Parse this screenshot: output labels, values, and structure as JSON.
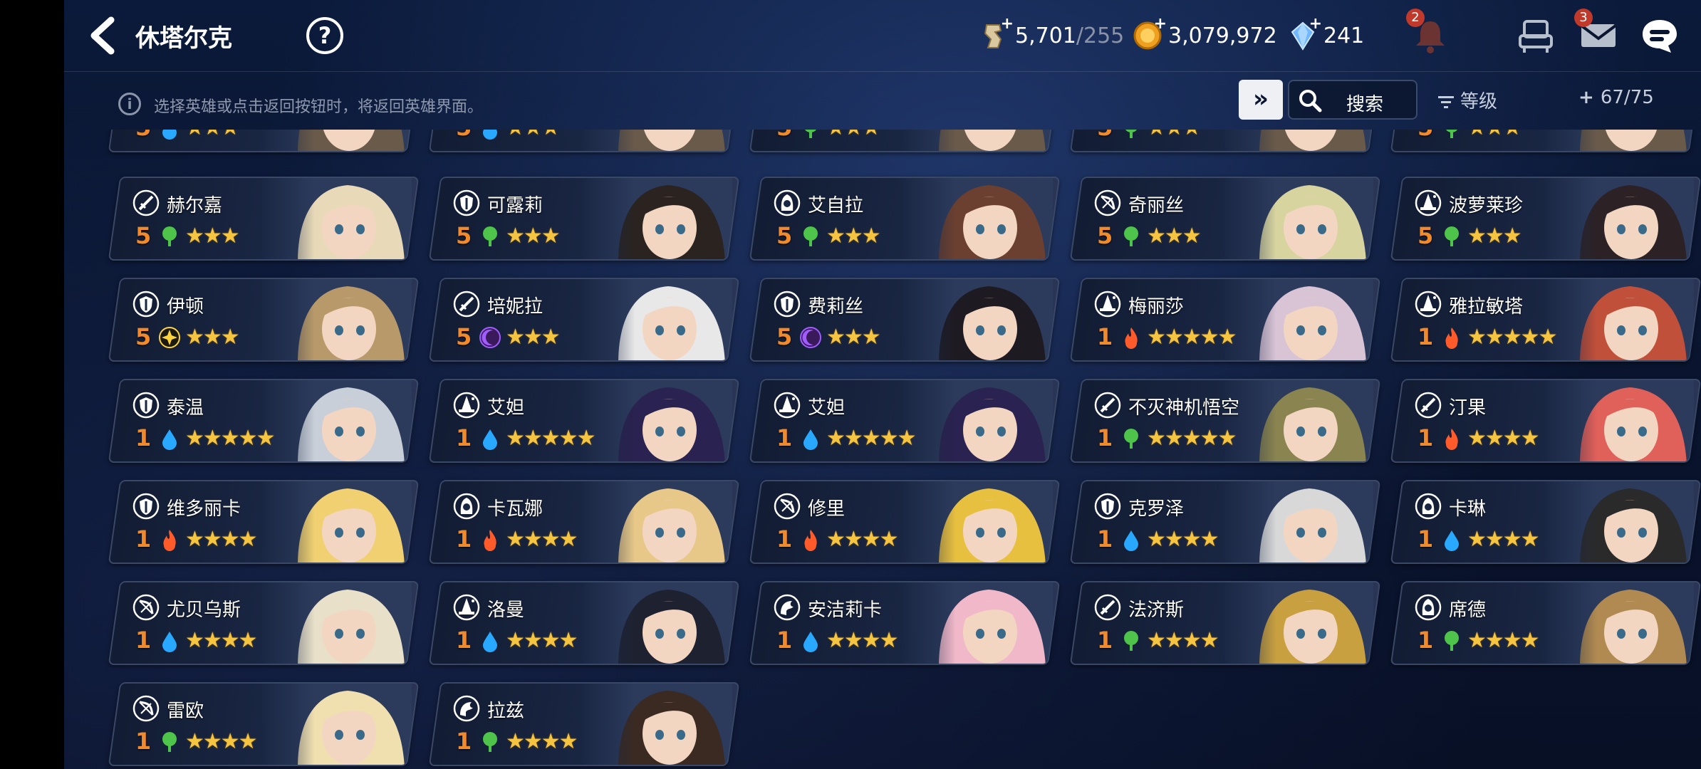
{
  "header": {
    "title": "休塔尔克",
    "help_label": "?",
    "stamina": "5,701",
    "stamina_max": "/255",
    "gold": "3,079,972",
    "gems": "241",
    "notifications_badge": "2",
    "mail_badge": "3"
  },
  "toolbar": {
    "info_text": "选择英雄或点击返回按钮时，将返回英雄界面。",
    "fastforward_label": "»",
    "search_label": "搜索",
    "sort_label": "等级",
    "count_label": "67/75"
  },
  "colors": {
    "level": "#f08a2a",
    "star": "#f5c542",
    "water": "#29a8ff",
    "earth": "#4fc44a",
    "fire": "#ff5a2a",
    "dark": "#a15cff",
    "light": "#ffd33d"
  },
  "partial_row": [
    {
      "level": "5",
      "element": "water",
      "stars": "★★★"
    },
    {
      "level": "5",
      "element": "water",
      "stars": "★★★"
    },
    {
      "level": "5",
      "element": "earth",
      "stars": "★★★"
    },
    {
      "level": "5",
      "element": "earth",
      "stars": "★★★"
    },
    {
      "level": "5",
      "element": "earth",
      "stars": "★★★"
    }
  ],
  "heroes": [
    {
      "name": "赫尔嘉",
      "level": "5",
      "element": "earth",
      "class": "sword-icon",
      "stars": "★★★",
      "hair": "#e8d9b8"
    },
    {
      "name": "可露莉",
      "level": "5",
      "element": "earth",
      "class": "shield-icon",
      "stars": "★★★",
      "hair": "#2a2320"
    },
    {
      "name": "艾自拉",
      "level": "5",
      "element": "earth",
      "class": "hood-icon",
      "stars": "★★★",
      "hair": "#6b4030"
    },
    {
      "name": "奇丽丝",
      "level": "5",
      "element": "earth",
      "class": "bow-icon",
      "stars": "★★★",
      "hair": "#d8d4a0"
    },
    {
      "name": "波萝莱珍",
      "level": "5",
      "element": "earth",
      "class": "witch-icon",
      "stars": "★★★",
      "hair": "#2c2226"
    },
    {
      "name": "伊顿",
      "level": "5",
      "element": "light",
      "class": "shield-icon",
      "stars": "★★★",
      "hair": "#b89a6a"
    },
    {
      "name": "培妮拉",
      "level": "5",
      "element": "dark",
      "class": "sword-icon",
      "stars": "★★★",
      "hair": "#e8e8e8"
    },
    {
      "name": "费莉丝",
      "level": "5",
      "element": "dark",
      "class": "shield-icon",
      "stars": "★★★",
      "hair": "#1e1a22"
    },
    {
      "name": "梅丽莎",
      "level": "1",
      "element": "fire",
      "class": "witch-icon",
      "stars": "★★★★★",
      "hair": "#d9c4d6"
    },
    {
      "name": "雅拉敏塔",
      "level": "1",
      "element": "fire",
      "class": "witch-icon",
      "stars": "★★★★★",
      "hair": "#c0503a"
    },
    {
      "name": "泰温",
      "level": "1",
      "element": "water",
      "class": "shield-icon",
      "stars": "★★★★★",
      "hair": "#c8cfd8"
    },
    {
      "name": "艾妲",
      "level": "1",
      "element": "water",
      "class": "witch-icon",
      "stars": "★★★★★",
      "hair": "#2a2250"
    },
    {
      "name": "艾妲",
      "level": "1",
      "element": "water",
      "class": "witch-icon",
      "stars": "★★★★★",
      "hair": "#2a2250"
    },
    {
      "name": "不灭神机悟空",
      "level": "1",
      "element": "earth",
      "class": "sword-icon",
      "stars": "★★★★★",
      "hair": "#8a8450"
    },
    {
      "name": "汀果",
      "level": "1",
      "element": "fire",
      "class": "sword-icon",
      "stars": "★★★★",
      "hair": "#e0605a"
    },
    {
      "name": "维多丽卡",
      "level": "1",
      "element": "fire",
      "class": "shield-icon",
      "stars": "★★★★",
      "hair": "#f0d070"
    },
    {
      "name": "卡瓦娜",
      "level": "1",
      "element": "fire",
      "class": "hood-icon",
      "stars": "★★★★",
      "hair": "#e8c888"
    },
    {
      "name": "修里",
      "level": "1",
      "element": "fire",
      "class": "bow-icon",
      "stars": "★★★★",
      "hair": "#e8c040"
    },
    {
      "name": "克罗泽",
      "level": "1",
      "element": "water",
      "class": "shield-icon",
      "stars": "★★★★",
      "hair": "#d8d8d8"
    },
    {
      "name": "卡琳",
      "level": "1",
      "element": "water",
      "class": "hood-icon",
      "stars": "★★★★",
      "hair": "#2a2a2a"
    },
    {
      "name": "尤贝乌斯",
      "level": "1",
      "element": "water",
      "class": "bow-icon",
      "stars": "★★★★",
      "hair": "#e8e0c8"
    },
    {
      "name": "洛曼",
      "level": "1",
      "element": "water",
      "class": "witch-icon",
      "stars": "★★★★",
      "hair": "#1e2230"
    },
    {
      "name": "安洁莉卡",
      "level": "1",
      "element": "water",
      "class": "dragon-icon",
      "stars": "★★★★",
      "hair": "#f0b8c8"
    },
    {
      "name": "法济斯",
      "level": "1",
      "element": "earth",
      "class": "sword-icon",
      "stars": "★★★★",
      "hair": "#c8a040"
    },
    {
      "name": "席德",
      "level": "1",
      "element": "earth",
      "class": "hood-icon",
      "stars": "★★★★",
      "hair": "#b08a50"
    },
    {
      "name": "雷欧",
      "level": "1",
      "element": "earth",
      "class": "bow-icon",
      "stars": "★★★★",
      "hair": "#f0e0b0"
    },
    {
      "name": "拉兹",
      "level": "1",
      "element": "earth",
      "class": "dragon-icon",
      "stars": "★★★★",
      "hair": "#3a2a22"
    }
  ]
}
